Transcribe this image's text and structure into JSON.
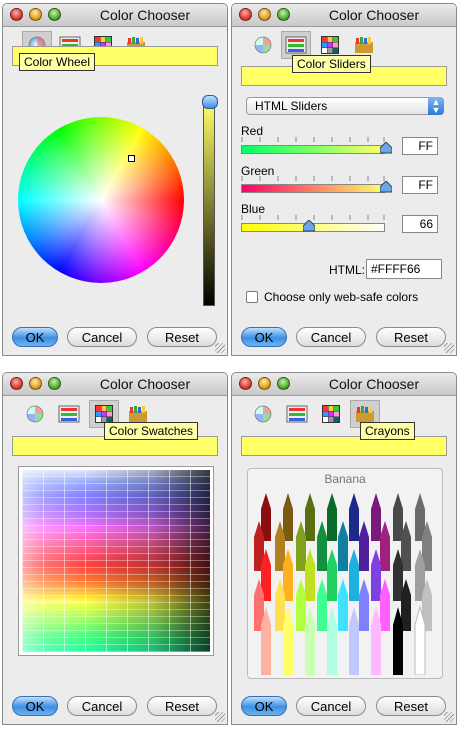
{
  "window_title": "Color Chooser",
  "buttons": {
    "ok": "OK",
    "cancel": "Cancel",
    "reset": "Reset"
  },
  "current_color": "#FFFF66",
  "panels": {
    "color_wheel": {
      "tooltip": "Color Wheel"
    },
    "color_sliders": {
      "tooltip": "Color Sliders",
      "mode": "HTML Sliders",
      "sliders": [
        {
          "label": "Red",
          "value": "FF"
        },
        {
          "label": "Green",
          "value": "FF"
        },
        {
          "label": "Blue",
          "value": "66"
        }
      ],
      "html_label": "HTML:",
      "html_value": "#FFFF66",
      "websafe_label": "Choose only web-safe colors"
    },
    "color_swatches": {
      "tooltip": "Color Swatches"
    },
    "crayons": {
      "tooltip": "Crayons",
      "selected_name": "Banana"
    }
  }
}
